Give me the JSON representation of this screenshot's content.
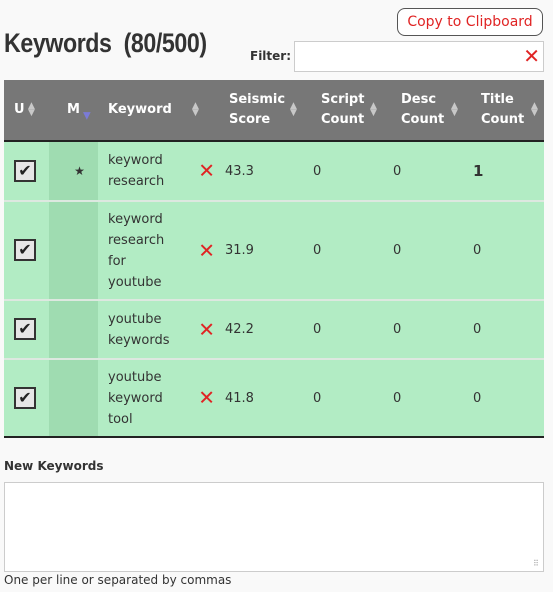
{
  "header": {
    "title": "Keywords  (80/500)",
    "copy_button": "Copy to Clipboard",
    "filter_label": "Filter:",
    "filter_value": "",
    "filter_placeholder": "",
    "filter_clear_icon": "✕"
  },
  "table": {
    "columns": [
      {
        "label": "U",
        "sort": "none"
      },
      {
        "label": "M",
        "sort": "desc"
      },
      {
        "label": "Keyword",
        "sort": "none"
      },
      {
        "label": "Seismic Score",
        "sort": "none"
      },
      {
        "label": "Script Count",
        "sort": "none"
      },
      {
        "label": "Desc Count",
        "sort": "none"
      },
      {
        "label": "Title Count",
        "sort": "none"
      }
    ],
    "sort_icon": "⇕",
    "sort_desc_icon": "▼",
    "check_icon": "✔",
    "star_icon": "★",
    "remove_icon": "✕",
    "rows": [
      {
        "used": true,
        "marked": true,
        "keyword": "keyword research",
        "seismic_score": "43.3",
        "script_count": "0",
        "desc_count": "0",
        "title_count": "1"
      },
      {
        "used": true,
        "marked": false,
        "keyword": "keyword research for youtube",
        "seismic_score": "31.9",
        "script_count": "0",
        "desc_count": "0",
        "title_count": "0"
      },
      {
        "used": true,
        "marked": false,
        "keyword": "youtube keywords",
        "seismic_score": "42.2",
        "script_count": "0",
        "desc_count": "0",
        "title_count": "0"
      },
      {
        "used": true,
        "marked": false,
        "keyword": "youtube keyword tool",
        "seismic_score": "41.8",
        "script_count": "0",
        "desc_count": "0",
        "title_count": "0"
      }
    ]
  },
  "new_keywords": {
    "label": "New Keywords",
    "value": "",
    "hint": "One per line or separated by commas"
  },
  "colors": {
    "accent_red": "#e02424",
    "header_gray": "#777777",
    "row_green": "#b2ecc4",
    "marked_col_green": "#9fdcb1"
  }
}
